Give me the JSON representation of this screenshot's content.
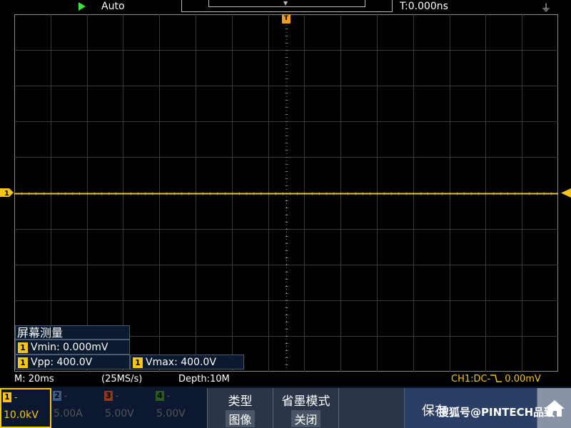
{
  "top_bar": {
    "run_icon": "play-icon",
    "trigger_mode": "Auto",
    "trigger_time": "T:0.000ns",
    "usb_icon": "usb-icon"
  },
  "screen": {
    "trigger_marker_label": "T",
    "ch1_marker_label": "1"
  },
  "measure": {
    "title": "屏幕测量",
    "channel": "1",
    "vmin": "Vmin: 0.000mV",
    "vpp": "Vpp: 400.0V",
    "vmax": "Vmax: 400.0V"
  },
  "info": {
    "timebase": "M: 20ms",
    "sample_rate": "(25MS/s)",
    "depth": "Depth:10M",
    "trigger_prefix": "CH1:DC-",
    "trigger_level": "0.00mV"
  },
  "channels": [
    {
      "num": "1",
      "dash": "-",
      "scale": "10.0kV",
      "color": "#f5c518",
      "active": true
    },
    {
      "num": "2",
      "dash": "-",
      "scale": "5.00A",
      "color": "#3b5a88",
      "active": false
    },
    {
      "num": "3",
      "dash": "-",
      "scale": "5.00V",
      "color": "#8a3a1e",
      "active": false
    },
    {
      "num": "4",
      "dash": "-",
      "scale": "5.00V",
      "color": "#2a5a22",
      "active": false
    }
  ],
  "menu": {
    "type_label": "类型",
    "type_value": "图像",
    "ink_label": "省墨模式",
    "ink_value": "关闭",
    "save_label": "保存",
    "home_icon": "home-icon"
  },
  "watermark": "搜狐号@PINTECH品致",
  "colors": {
    "ch1": "#f5c518",
    "trigger": "#f0a020",
    "run": "#3ee23e"
  }
}
